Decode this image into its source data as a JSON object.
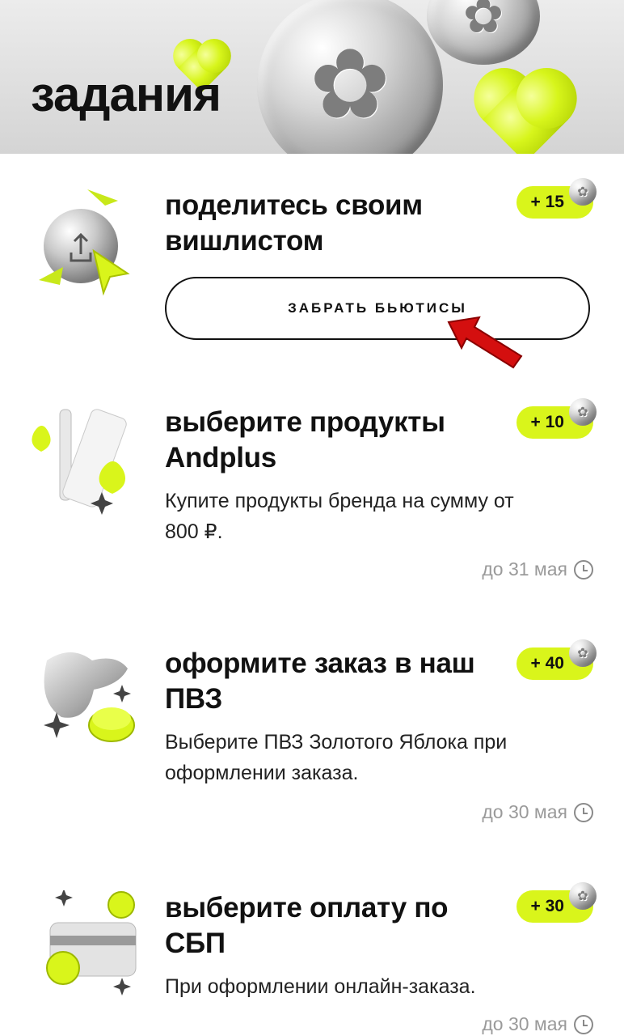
{
  "header": {
    "title": "задания"
  },
  "tasks": [
    {
      "title": "поделитесь своим вишлистом",
      "reward": "+ 15",
      "button_label": "ЗАБРАТЬ БЬЮТИСЫ"
    },
    {
      "title": "выберите продукты Andplus",
      "reward": "+ 10",
      "description": "Купите продукты бренда на сумму от 800 ₽.",
      "deadline": "до 31 мая"
    },
    {
      "title": "оформите заказ в наш ПВЗ",
      "reward": "+ 40",
      "description": "Выберите ПВЗ Золотого Яблока при оформлении заказа.",
      "deadline": "до 30 мая"
    },
    {
      "title": "выберите оплату по СБП",
      "reward": "+ 30",
      "description": "При оформлении онлайн-заказа.",
      "deadline": "до 30 мая"
    }
  ],
  "colors": {
    "accent": "#d9f51b",
    "pointer_arrow": "#d40f0f"
  }
}
